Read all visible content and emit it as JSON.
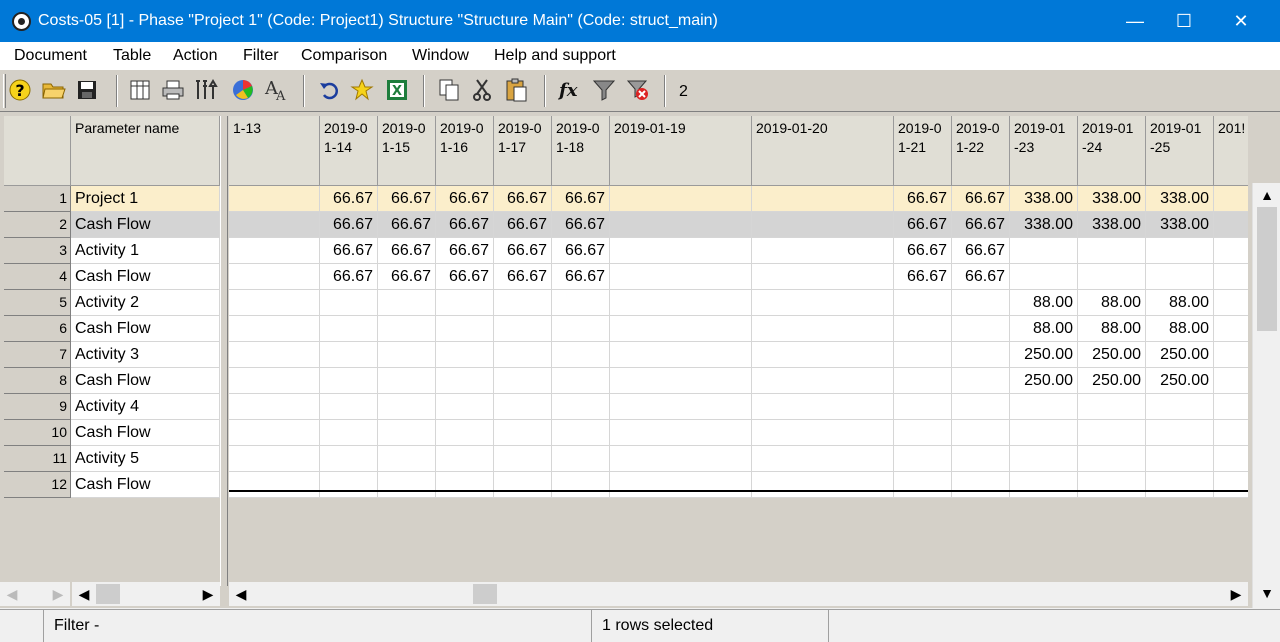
{
  "window": {
    "title": "Costs-05 [1] - Phase \"Project 1\" (Code: Project1) Structure \"Structure Main\" (Code: struct_main)",
    "minimize": "—",
    "maximize": "☐",
    "close": "✕"
  },
  "menu": [
    "Document",
    "Table",
    "Action",
    "Filter",
    "Comparison",
    "Window",
    "Help and support"
  ],
  "toolbar": {
    "icons": [
      "help-icon",
      "open-folder-icon",
      "save-icon",
      "columns-icon",
      "print-icon",
      "tools-icon",
      "pie-chart-icon",
      "font-icon",
      "undo-icon",
      "star-icon",
      "excel-icon",
      "copy-icon",
      "cut-icon",
      "paste-icon",
      "formula-icon",
      "filter-icon",
      "clear-filter-icon"
    ],
    "counter": "2"
  },
  "grid": {
    "name_header": "Parameter name",
    "date_headers": [
      "1-13",
      "2019-0\n1-14",
      "2019-0\n1-15",
      "2019-0\n1-16",
      "2019-0\n1-17",
      "2019-0\n1-18",
      "2019-01-19",
      "2019-01-20",
      "2019-0\n1-21",
      "2019-0\n1-22",
      "2019-01\n-23",
      "2019-01\n-24",
      "2019-01\n-25",
      "201!"
    ],
    "rows": [
      {
        "num": "1",
        "name": "Project 1",
        "values": [
          "",
          "66.67",
          "66.67",
          "66.67",
          "66.67",
          "66.67",
          "",
          "",
          "66.67",
          "66.67",
          "338.00",
          "338.00",
          "338.00",
          ""
        ]
      },
      {
        "num": "2",
        "name": "Cash Flow",
        "values": [
          "",
          "66.67",
          "66.67",
          "66.67",
          "66.67",
          "66.67",
          "",
          "",
          "66.67",
          "66.67",
          "338.00",
          "338.00",
          "338.00",
          ""
        ]
      },
      {
        "num": "3",
        "name": "Activity 1",
        "values": [
          "",
          "66.67",
          "66.67",
          "66.67",
          "66.67",
          "66.67",
          "",
          "",
          "66.67",
          "66.67",
          "",
          "",
          "",
          ""
        ]
      },
      {
        "num": "4",
        "name": "Cash Flow",
        "values": [
          "",
          "66.67",
          "66.67",
          "66.67",
          "66.67",
          "66.67",
          "",
          "",
          "66.67",
          "66.67",
          "",
          "",
          "",
          ""
        ]
      },
      {
        "num": "5",
        "name": "Activity 2",
        "values": [
          "",
          "",
          "",
          "",
          "",
          "",
          "",
          "",
          "",
          "",
          "88.00",
          "88.00",
          "88.00",
          ""
        ]
      },
      {
        "num": "6",
        "name": "Cash Flow",
        "values": [
          "",
          "",
          "",
          "",
          "",
          "",
          "",
          "",
          "",
          "",
          "88.00",
          "88.00",
          "88.00",
          ""
        ]
      },
      {
        "num": "7",
        "name": "Activity 3",
        "values": [
          "",
          "",
          "",
          "",
          "",
          "",
          "",
          "",
          "",
          "",
          "250.00",
          "250.00",
          "250.00",
          ""
        ]
      },
      {
        "num": "8",
        "name": "Cash Flow",
        "values": [
          "",
          "",
          "",
          "",
          "",
          "",
          "",
          "",
          "",
          "",
          "250.00",
          "250.00",
          "250.00",
          ""
        ]
      },
      {
        "num": "9",
        "name": "Activity 4",
        "values": [
          "",
          "",
          "",
          "",
          "",
          "",
          "",
          "",
          "",
          "",
          "",
          "",
          "",
          ""
        ]
      },
      {
        "num": "10",
        "name": "Cash Flow",
        "values": [
          "",
          "",
          "",
          "",
          "",
          "",
          "",
          "",
          "",
          "",
          "",
          "",
          "",
          ""
        ]
      },
      {
        "num": "11",
        "name": "Activity 5",
        "values": [
          "",
          "",
          "",
          "",
          "",
          "",
          "",
          "",
          "",
          "",
          "",
          "",
          "",
          ""
        ]
      },
      {
        "num": "12",
        "name": "Cash Flow",
        "values": [
          "",
          "",
          "",
          "",
          "",
          "",
          "",
          "",
          "",
          "",
          "",
          "",
          "",
          ""
        ]
      }
    ]
  },
  "status": {
    "filter": "Filter -",
    "selection": "1 rows selected"
  },
  "colors": {
    "titlebar": "#0078d7",
    "selected_row": "#fbeecb",
    "current_row": "#d4d4d4"
  }
}
